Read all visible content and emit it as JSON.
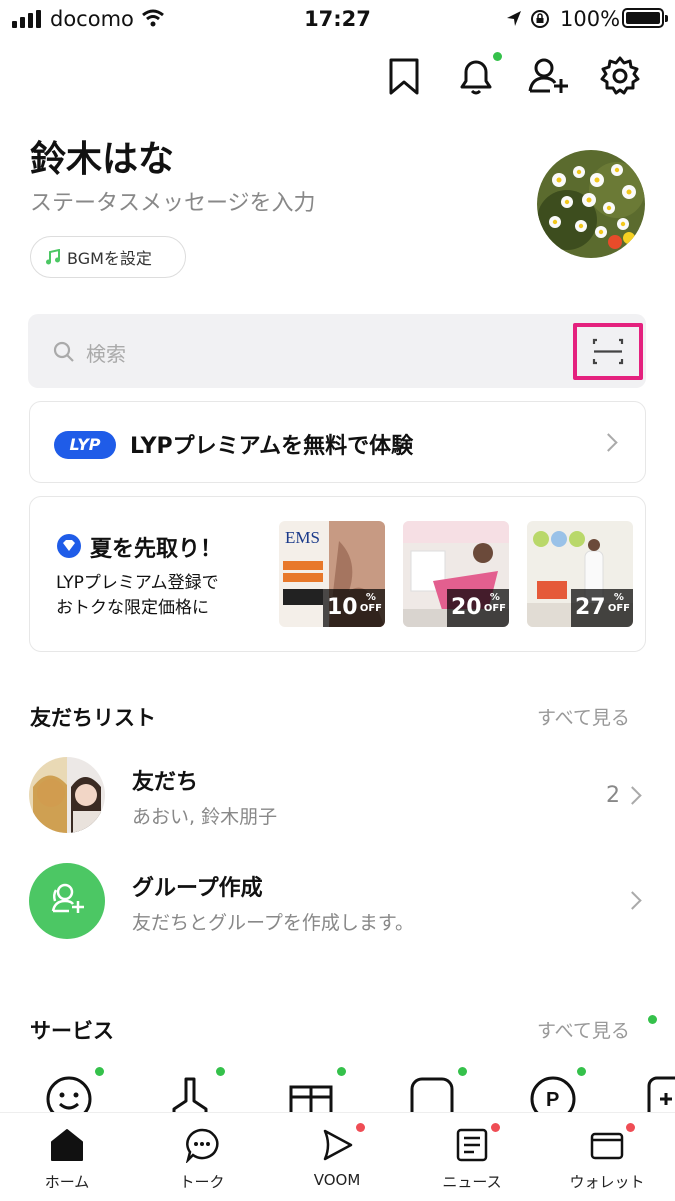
{
  "status_bar": {
    "carrier": "docomo",
    "time": "17:27",
    "battery": "100%"
  },
  "profile": {
    "name": "鈴木はな",
    "status_placeholder": "ステータスメッセージを入力",
    "bgm_label": "BGMを設定"
  },
  "search": {
    "placeholder": "検索"
  },
  "lyp_banner": {
    "badge": "LYP",
    "text": "LYPプレミアムを無料で体験"
  },
  "promo": {
    "title": "夏を先取り！",
    "line1": "LYPプレミアム登録で",
    "line2": "おトクな限定価格に",
    "items": [
      {
        "discount": "10",
        "unit": "%",
        "off": "OFF",
        "caption": "EMS"
      },
      {
        "discount": "20",
        "unit": "%",
        "off": "OFF"
      },
      {
        "discount": "27",
        "unit": "%",
        "off": "OFF"
      }
    ]
  },
  "friends_section": {
    "title": "友だちリスト",
    "see_all": "すべて見る",
    "rows": [
      {
        "title": "友だち",
        "subtitle": "あおい, 鈴木朋子",
        "count": "2"
      },
      {
        "title": "グループ作成",
        "subtitle": "友だちとグループを作成します。"
      }
    ]
  },
  "services_section": {
    "title": "サービス",
    "see_all": "すべて見る"
  },
  "bottom_nav": [
    {
      "label": "ホーム"
    },
    {
      "label": "トーク"
    },
    {
      "label": "VOOM"
    },
    {
      "label": "ニュース"
    },
    {
      "label": "ウォレット"
    }
  ],
  "colors": {
    "accent_green": "#4cc764",
    "badge_red": "#ef4d55",
    "highlight_pink": "#e4217e",
    "lyp_blue": "#1f5ce8"
  }
}
